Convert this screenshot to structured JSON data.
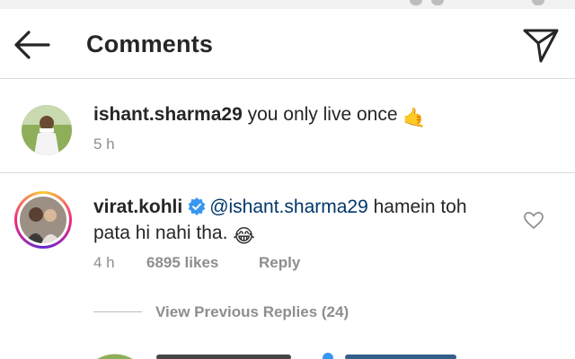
{
  "header": {
    "title": "Comments",
    "back_icon": "arrow-left-icon",
    "send_icon": "paper-plane-icon"
  },
  "caption": {
    "username": "ishant.sharma29",
    "text": "you only live once",
    "emoji": "🤙",
    "time": "5 h"
  },
  "comment": {
    "username": "virat.kohli",
    "verified": true,
    "mention": "@ishant.sharma29",
    "text_line1": "hamein toh",
    "text_line2": "pata hi nahi tha.",
    "emoji": "😂",
    "time": "4 h",
    "likes": "6895 likes",
    "reply_label": "Reply",
    "heart_icon": "heart-outline-icon"
  },
  "replies": {
    "view_label": "View Previous Replies (24)"
  },
  "colors": {
    "text": "#262626",
    "muted": "#8e8e8e",
    "mention": "#00376b",
    "verified": "#3897f0",
    "divider": "#dbdbdb"
  }
}
